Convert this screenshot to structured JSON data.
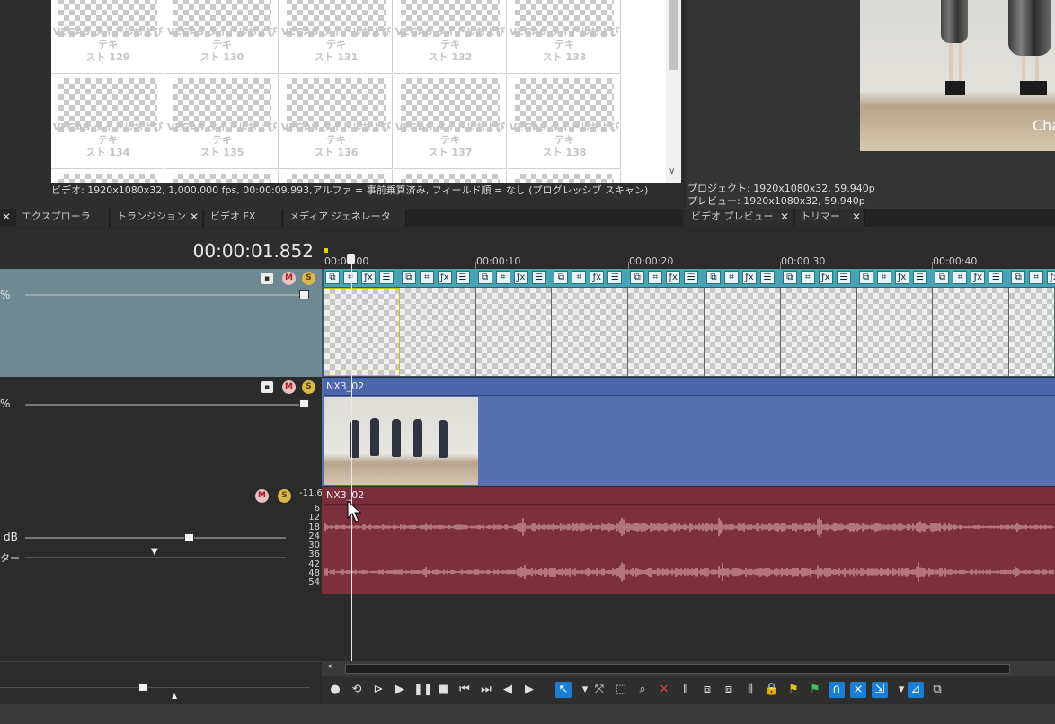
{
  "media_generator": {
    "items": [
      {
        "title": "VEGAS タイトルおよびテキ",
        "sub": "スト 129"
      },
      {
        "title": "VEGAS タイトルおよびテキ",
        "sub": "スト 130"
      },
      {
        "title": "VEGAS タイトルおよびテキ",
        "sub": "スト 131"
      },
      {
        "title": "VEGAS タイトルおよびテキ",
        "sub": "スト 132"
      },
      {
        "title": "VEGAS タイトルおよびテキ",
        "sub": "スト 133"
      },
      {
        "title": "VEGAS タイトルおよびテキ",
        "sub": "スト 134"
      },
      {
        "title": "VEGAS タイトルおよびテキ",
        "sub": "スト 135"
      },
      {
        "title": "VEGAS タイトルおよびテキ",
        "sub": "スト 136"
      },
      {
        "title": "VEGAS タイトルおよびテキ",
        "sub": "スト 137"
      },
      {
        "title": "VEGAS タイトルおよびテキ",
        "sub": "スト 138"
      }
    ],
    "status": "ビデオ: 1920x1080x32, 1,000.000 fps, 00:00:09.993,アルファ = 事前乗算済み, フィールド順 = なし (プログレッシブ スキャン)"
  },
  "left_tabs": [
    {
      "label": "エクスプローラ"
    },
    {
      "label": "トランジション"
    },
    {
      "label": "ビデオ FX"
    },
    {
      "label": "メディア ジェネレータ"
    }
  ],
  "preview": {
    "overlay_text": "Cha",
    "project_info": "プロジェクト: 1920x1080x32, 59.940p",
    "preview_info": "プレビュー:   1920x1080x32, 59.940p",
    "tabs": [
      {
        "label": "ビデオ プレビュー"
      },
      {
        "label": "トリマー"
      }
    ]
  },
  "timeline": {
    "timecode": "00:00:01.852",
    "ruler_labels": [
      "00:00:00",
      "00:00:10",
      "00:00:20",
      "00:00:30",
      "00:00:40"
    ],
    "tracks": [
      {
        "type": "video",
        "level": "%",
        "color": "#6e8894"
      },
      {
        "type": "video",
        "level": "%",
        "clip_name": "NX3_02",
        "color": "#5870b0"
      },
      {
        "type": "audio",
        "volume_unit": "dB",
        "peak": "-11.6",
        "pan_label": "ター",
        "clip_name": "NX3_02",
        "color": "#7d2f3b",
        "db_scale": [
          "6",
          "12",
          "18",
          "24",
          "30",
          "36",
          "42",
          "48",
          "54"
        ]
      }
    ]
  },
  "transport": {
    "buttons": [
      {
        "icon": "record-icon",
        "glyph": "●"
      },
      {
        "icon": "loop-icon",
        "glyph": "⟲"
      },
      {
        "icon": "play-from-start-icon",
        "glyph": "⊳"
      },
      {
        "icon": "play-icon",
        "glyph": "▶"
      },
      {
        "icon": "pause-icon",
        "glyph": "❚❚"
      },
      {
        "icon": "stop-icon",
        "glyph": "■"
      },
      {
        "icon": "go-to-start-icon",
        "glyph": "⏮"
      },
      {
        "icon": "go-to-end-icon",
        "glyph": "⏭"
      },
      {
        "icon": "prev-frame-icon",
        "glyph": "◀"
      },
      {
        "icon": "next-frame-icon",
        "glyph": "▶"
      }
    ],
    "edit_tools": [
      {
        "icon": "normal-edit-tool-icon",
        "glyph": "↖",
        "active": true
      },
      {
        "icon": "dropdown-icon",
        "glyph": "▾",
        "active": false
      },
      {
        "icon": "envelope-tool-icon",
        "glyph": "⤧",
        "active": false
      },
      {
        "icon": "selection-tool-icon",
        "glyph": "⬚",
        "active": false
      },
      {
        "icon": "zoom-tool-icon",
        "glyph": "⌕",
        "active": false
      },
      {
        "icon": "delete-icon",
        "glyph": "✕",
        "active": false
      },
      {
        "icon": "trim-icon",
        "glyph": "⫴",
        "active": false
      },
      {
        "icon": "trim-start-icon",
        "glyph": "⧈",
        "active": false
      },
      {
        "icon": "trim-end-icon",
        "glyph": "⧈",
        "active": false
      },
      {
        "icon": "split-icon",
        "glyph": "⫼",
        "active": false
      },
      {
        "icon": "lock-icon",
        "glyph": "🔒",
        "active": false
      },
      {
        "icon": "marker-icon",
        "glyph": "⚑",
        "active": false
      },
      {
        "icon": "region-icon",
        "glyph": "⚑",
        "active": false
      },
      {
        "icon": "snapping-icon",
        "glyph": "∩",
        "active": true
      },
      {
        "icon": "auto-crossfade-icon",
        "glyph": "⨯",
        "active": true
      },
      {
        "icon": "ripple-icon",
        "glyph": "⇲",
        "active": true
      },
      {
        "icon": "dropdown-icon",
        "glyph": "▾",
        "active": false
      },
      {
        "icon": "lock-envelopes-icon",
        "glyph": "⊿",
        "active": true
      },
      {
        "icon": "ignore-grouping-icon",
        "glyph": "⧉",
        "active": false
      }
    ]
  }
}
